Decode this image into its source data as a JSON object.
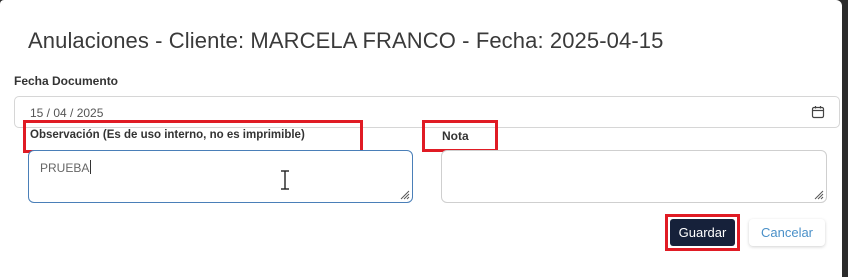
{
  "dialog": {
    "title": "Anulaciones - Cliente: MARCELA FRANCO - Fecha: 2025-04-15"
  },
  "fecha_documento": {
    "label": "Fecha Documento",
    "value": "15 / 04 / 2025",
    "icon": "calendar-icon"
  },
  "observacion": {
    "label": "Observación (Es de uso interno, no es imprimible)",
    "value": "PRUEBA"
  },
  "nota": {
    "label": "Nota",
    "value": ""
  },
  "actions": {
    "save_label": "Guardar",
    "cancel_label": "Cancelar"
  },
  "colors": {
    "highlight": "#e01b24",
    "save_bg": "#16213a",
    "cancel_text": "#4a90c8",
    "focus_border": "#4a7fb8"
  }
}
